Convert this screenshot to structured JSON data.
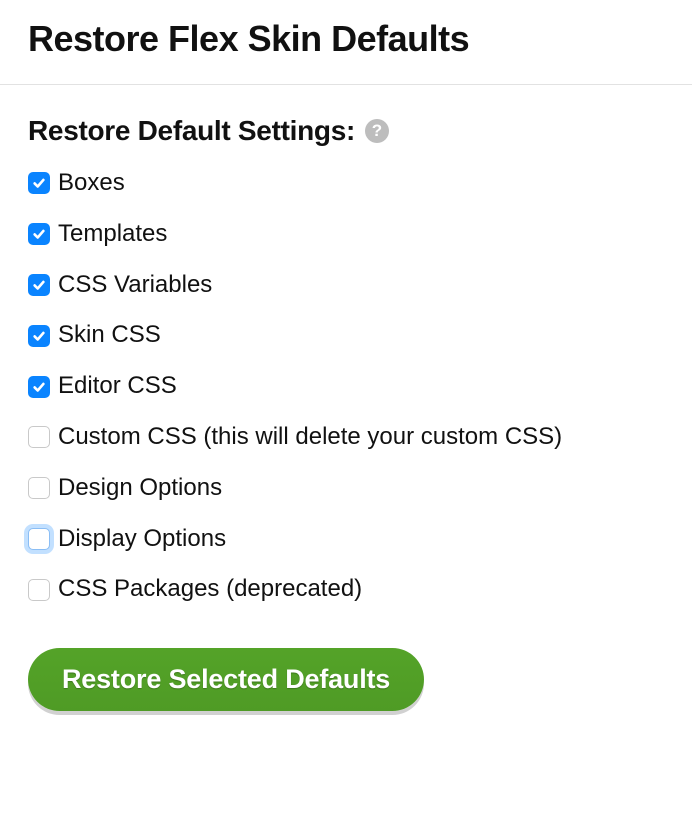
{
  "title": "Restore Flex Skin Defaults",
  "section_title": "Restore Default Settings:",
  "help_tooltip": "?",
  "options": [
    {
      "label": "Boxes",
      "checked": true,
      "focused": false
    },
    {
      "label": "Templates",
      "checked": true,
      "focused": false
    },
    {
      "label": "CSS Variables",
      "checked": true,
      "focused": false
    },
    {
      "label": "Skin CSS",
      "checked": true,
      "focused": false
    },
    {
      "label": "Editor CSS",
      "checked": true,
      "focused": false
    },
    {
      "label": "Custom CSS (this will delete your custom CSS)",
      "checked": false,
      "focused": false
    },
    {
      "label": "Design Options",
      "checked": false,
      "focused": false
    },
    {
      "label": "Display Options",
      "checked": false,
      "focused": true
    },
    {
      "label": "CSS Packages (deprecated)",
      "checked": false,
      "focused": false
    }
  ],
  "submit_label": "Restore Selected Defaults"
}
